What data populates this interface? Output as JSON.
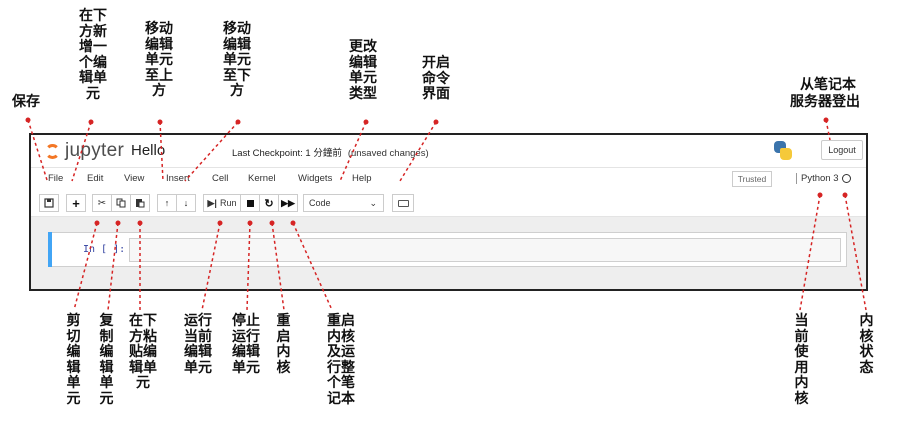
{
  "notebook": {
    "logo_text": "jupyter",
    "name": "Hello",
    "checkpoint": "Last Checkpoint: 1 分鐘前",
    "unsaved": "(unsaved changes)",
    "logout_label": "Logout",
    "python_logo_icon": "python-logo-icon"
  },
  "menubar": {
    "items": [
      "File",
      "Edit",
      "View",
      "Insert",
      "Cell",
      "Kernel",
      "Widgets",
      "Help"
    ],
    "trusted": "Trusted",
    "kernel_name": "Python 3",
    "kernel_state_icon": "kernel-idle-circle-icon"
  },
  "toolbar": {
    "save_icon": "save-icon",
    "insert_icon": "plus-icon",
    "cut_icon": "scissors-icon",
    "copy_icon": "copy-icon",
    "paste_icon": "paste-icon",
    "up_icon": "arrow-up-icon",
    "down_icon": "arrow-down-icon",
    "run_label": "Run",
    "stop_icon": "stop-icon",
    "restart_icon": "restart-icon",
    "restart_run_all_icon": "fast-forward-icon",
    "cell_type": "Code",
    "command_palette_icon": "keyboard-icon"
  },
  "cell": {
    "prompt": "In [ ]:"
  },
  "annotations": {
    "save": "保存",
    "insert_below": "在下方新增一个编辑单元",
    "move_up": "移动编辑单元至上方",
    "move_down": "移动编辑单元至下方",
    "change_type": "更改编辑单元类型",
    "command_palette": "开启命令界面",
    "logout_line1": "从笔记本",
    "logout_line2": "服务器登出",
    "cut": "剪切编辑单元",
    "copy": "复制编辑单元",
    "paste": "在下方粘贴编辑单元",
    "run": "运行当前编辑单元",
    "stop": "停止运行编辑单元",
    "restart": "重启内核",
    "restart_run_all": "重启内核及运行整个笔记本",
    "current_kernel": "当前使用内核",
    "kernel_state": "内核状态"
  },
  "colors": {
    "leader": "#d62424",
    "selection_bar": "#42a5f5",
    "jupyter_orange": "#f37726"
  }
}
